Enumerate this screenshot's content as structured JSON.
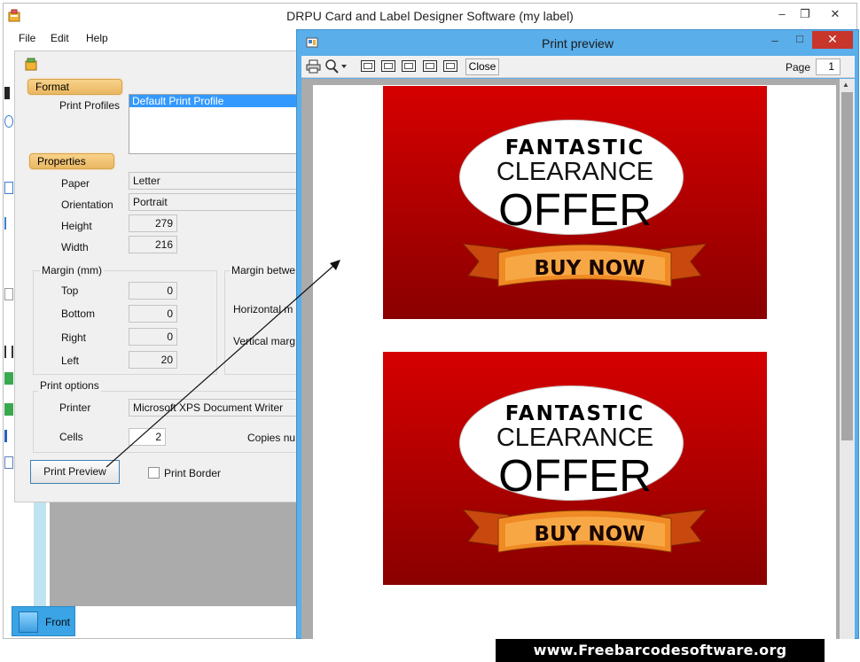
{
  "main_window": {
    "title": "DRPU Card and Label Designer Software  (my label)",
    "menu": [
      "File",
      "Edit",
      "Help"
    ],
    "minimize": "–",
    "restore": "❐",
    "close": "✕"
  },
  "settings": {
    "format_tab": "Format",
    "print_profiles_label": "Print Profiles",
    "print_profiles_selected": "Default Print Profile",
    "properties_tab": "Properties",
    "paper_label": "Paper",
    "paper_value": "Letter",
    "orientation_label": "Orientation",
    "orientation_value": "Portrait",
    "height_label": "Height",
    "height_value": "279",
    "width_label": "Width",
    "width_value": "216",
    "margin_group": "Margin (mm)",
    "margin_between_group": "Margin betwe",
    "top_label": "Top",
    "top_value": "0",
    "bottom_label": "Bottom",
    "bottom_value": "0",
    "right_label": "Right",
    "right_value": "0",
    "left_label": "Left",
    "left_value": "20",
    "horizontal_label": "Horizontal m",
    "vertical_label": "Vertical marg",
    "print_options_group": "Print options",
    "printer_label": "Printer",
    "printer_value": "Microsoft XPS Document Writer",
    "cells_label": "Cells",
    "cells_value": "2",
    "copies_label": "Copies nu",
    "print_preview_button": "Print Preview",
    "print_border_label": "Print Border"
  },
  "front_tab": "Front",
  "preview": {
    "title": "Print preview",
    "minimize": "–",
    "restore": "□",
    "close": "✕",
    "close_button": "Close",
    "page_label": "Page",
    "page_value": "1"
  },
  "labels": [
    {
      "line1": "FANTASTIC",
      "line2": "CLEARANCE",
      "line3": "OFFER",
      "banner": "BUY NOW"
    },
    {
      "line1": "FANTASTIC",
      "line2": "CLEARANCE",
      "line3": "OFFER",
      "banner": "BUY NOW"
    }
  ],
  "footer_url": "www.Freebarcodesoftware.org",
  "colors": {
    "label_red_top": "#d60000",
    "label_red_bottom": "#8a0000",
    "preview_frame": "#5aaeea",
    "section_tab": "#e9b761",
    "close_red": "#c7352b"
  },
  "icons": [
    "app-icon",
    "printer-icon",
    "zoom-icon",
    "one-page-icon",
    "two-page-icon",
    "three-page-icon",
    "four-page-icon",
    "six-page-icon",
    "document-icon",
    "ribbon-banner-icon"
  ]
}
